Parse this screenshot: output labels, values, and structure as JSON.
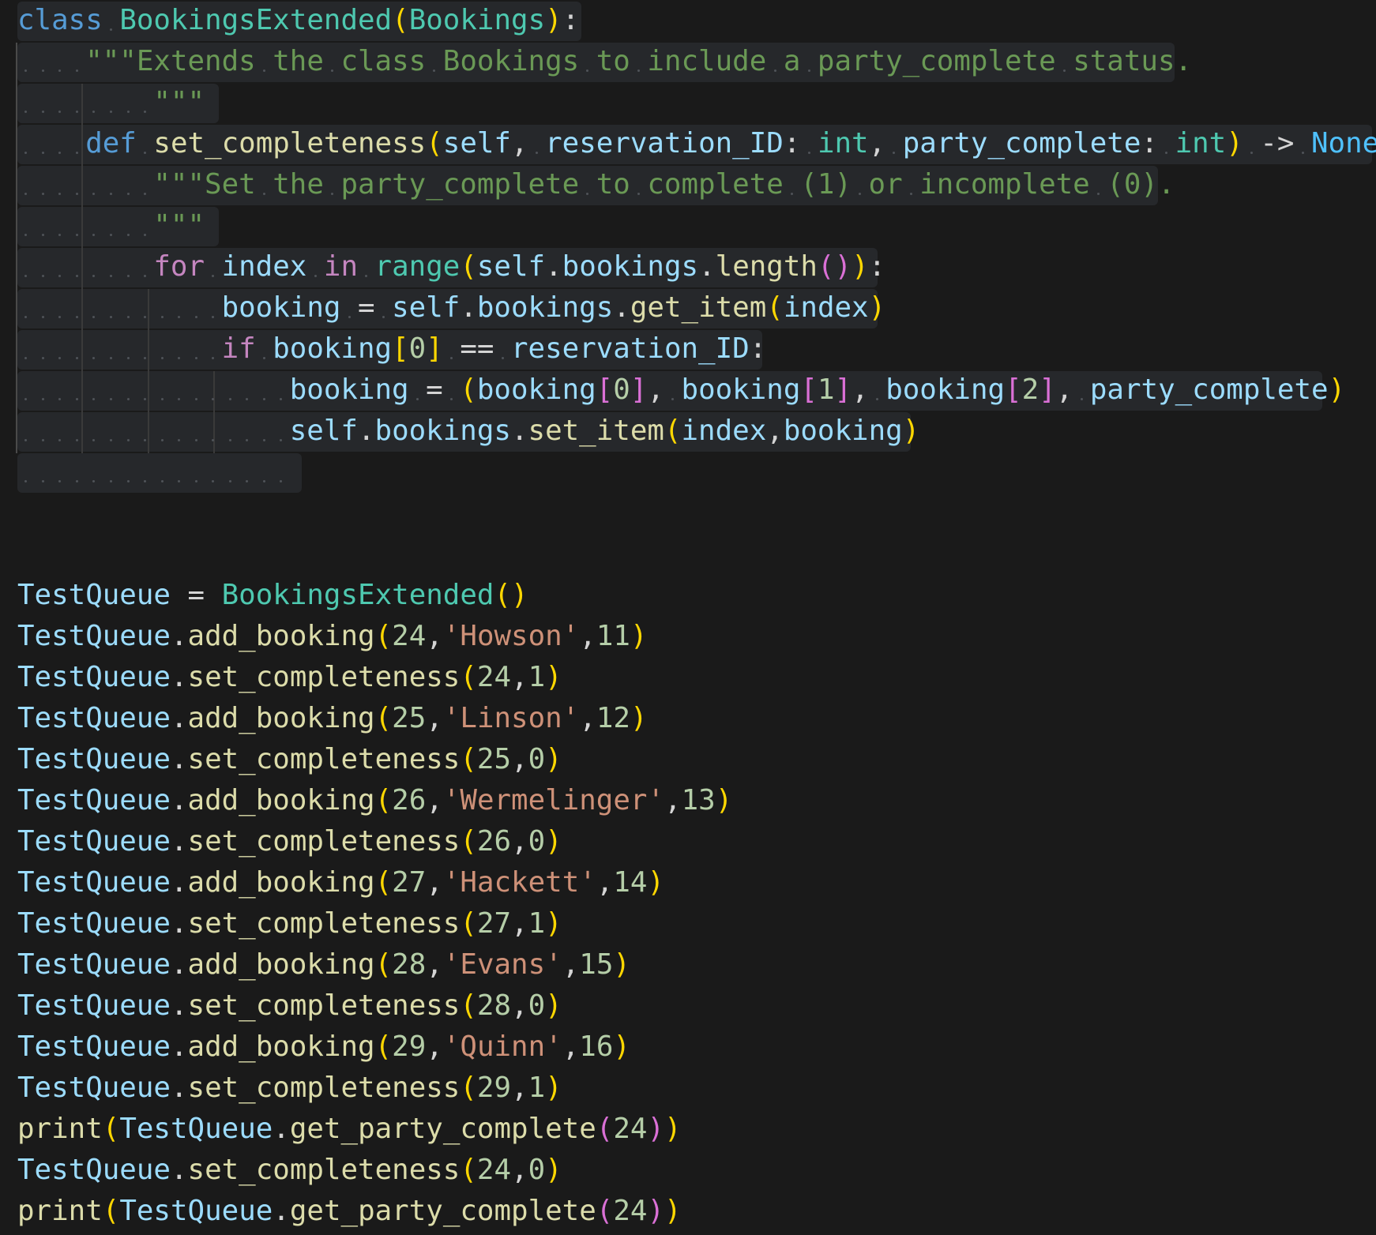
{
  "editor": {
    "language": "python",
    "lines": [
      [
        [
          "kw",
          "class"
        ],
        [
          "sp",
          " "
        ],
        [
          "cls",
          "BookingsExtended"
        ],
        [
          "b1",
          "("
        ],
        [
          "cls",
          "Bookings"
        ],
        [
          "b1",
          ")"
        ],
        [
          "op",
          ":"
        ]
      ],
      [
        [
          "sp",
          "    "
        ],
        [
          "doc",
          "\"\"\"Extends the class Bookings to include a party_complete status."
        ]
      ],
      [
        [
          "sp",
          "        "
        ],
        [
          "doc",
          "\"\"\""
        ]
      ],
      [
        [
          "sp",
          "    "
        ],
        [
          "kw",
          "def"
        ],
        [
          "sp",
          " "
        ],
        [
          "fn",
          "set_completeness"
        ],
        [
          "b1",
          "("
        ],
        [
          "var",
          "self"
        ],
        [
          "op",
          ","
        ],
        [
          "sp",
          " "
        ],
        [
          "var",
          "reservation_ID"
        ],
        [
          "op",
          ":"
        ],
        [
          "sp",
          " "
        ],
        [
          "bi",
          "int"
        ],
        [
          "op",
          ","
        ],
        [
          "sp",
          " "
        ],
        [
          "var",
          "party_complete"
        ],
        [
          "op",
          ":"
        ],
        [
          "sp",
          " "
        ],
        [
          "bi",
          "int"
        ],
        [
          "b1",
          ")"
        ],
        [
          "sp",
          " "
        ],
        [
          "op",
          "->"
        ],
        [
          "sp",
          " "
        ],
        [
          "const",
          "None"
        ],
        [
          "op",
          ":"
        ]
      ],
      [
        [
          "sp",
          "        "
        ],
        [
          "doc",
          "\"\"\"Set the party_complete to complete (1) or incomplete (0)."
        ]
      ],
      [
        [
          "sp",
          "        "
        ],
        [
          "doc",
          "\"\"\""
        ]
      ],
      [
        [
          "sp",
          "        "
        ],
        [
          "ctl",
          "for"
        ],
        [
          "sp",
          " "
        ],
        [
          "var",
          "index"
        ],
        [
          "sp",
          " "
        ],
        [
          "ctl",
          "in"
        ],
        [
          "sp",
          " "
        ],
        [
          "bi",
          "range"
        ],
        [
          "b1",
          "("
        ],
        [
          "var",
          "self"
        ],
        [
          "op",
          "."
        ],
        [
          "var",
          "bookings"
        ],
        [
          "op",
          "."
        ],
        [
          "fn",
          "length"
        ],
        [
          "b2",
          "()"
        ],
        [
          "b1",
          ")"
        ],
        [
          "op",
          ":"
        ]
      ],
      [
        [
          "sp",
          "            "
        ],
        [
          "var",
          "booking"
        ],
        [
          "sp",
          " "
        ],
        [
          "op",
          "="
        ],
        [
          "sp",
          " "
        ],
        [
          "var",
          "self"
        ],
        [
          "op",
          "."
        ],
        [
          "var",
          "bookings"
        ],
        [
          "op",
          "."
        ],
        [
          "fn",
          "get_item"
        ],
        [
          "b1",
          "("
        ],
        [
          "var",
          "index"
        ],
        [
          "b1",
          ")"
        ]
      ],
      [
        [
          "sp",
          "            "
        ],
        [
          "ctl",
          "if"
        ],
        [
          "sp",
          " "
        ],
        [
          "var",
          "booking"
        ],
        [
          "b1",
          "["
        ],
        [
          "num",
          "0"
        ],
        [
          "b1",
          "]"
        ],
        [
          "sp",
          " "
        ],
        [
          "op",
          "=="
        ],
        [
          "sp",
          " "
        ],
        [
          "var",
          "reservation_ID"
        ],
        [
          "op",
          ":"
        ]
      ],
      [
        [
          "sp",
          "                "
        ],
        [
          "var",
          "booking"
        ],
        [
          "sp",
          " "
        ],
        [
          "op",
          "="
        ],
        [
          "sp",
          " "
        ],
        [
          "b1",
          "("
        ],
        [
          "var",
          "booking"
        ],
        [
          "b2",
          "["
        ],
        [
          "num",
          "0"
        ],
        [
          "b2",
          "]"
        ],
        [
          "op",
          ","
        ],
        [
          "sp",
          " "
        ],
        [
          "var",
          "booking"
        ],
        [
          "b2",
          "["
        ],
        [
          "num",
          "1"
        ],
        [
          "b2",
          "]"
        ],
        [
          "op",
          ","
        ],
        [
          "sp",
          " "
        ],
        [
          "var",
          "booking"
        ],
        [
          "b2",
          "["
        ],
        [
          "num",
          "2"
        ],
        [
          "b2",
          "]"
        ],
        [
          "op",
          ","
        ],
        [
          "sp",
          " "
        ],
        [
          "var",
          "party_complete"
        ],
        [
          "b1",
          ")"
        ]
      ],
      [
        [
          "sp",
          "                "
        ],
        [
          "var",
          "self"
        ],
        [
          "op",
          "."
        ],
        [
          "var",
          "bookings"
        ],
        [
          "op",
          "."
        ],
        [
          "fn",
          "set_item"
        ],
        [
          "b1",
          "("
        ],
        [
          "var",
          "index"
        ],
        [
          "op",
          ","
        ],
        [
          "var",
          "booking"
        ],
        [
          "b1",
          ")"
        ]
      ],
      [
        [
          "sp",
          "                "
        ]
      ],
      [],
      [],
      [
        [
          "var",
          "TestQueue"
        ],
        [
          "op",
          " = "
        ],
        [
          "cls",
          "BookingsExtended"
        ],
        [
          "b1",
          "()"
        ]
      ],
      [
        [
          "var",
          "TestQueue"
        ],
        [
          "op",
          "."
        ],
        [
          "fn",
          "add_booking"
        ],
        [
          "b1",
          "("
        ],
        [
          "num",
          "24"
        ],
        [
          "op",
          ","
        ],
        [
          "str",
          "'Howson'"
        ],
        [
          "op",
          ","
        ],
        [
          "num",
          "11"
        ],
        [
          "b1",
          ")"
        ]
      ],
      [
        [
          "var",
          "TestQueue"
        ],
        [
          "op",
          "."
        ],
        [
          "fn",
          "set_completeness"
        ],
        [
          "b1",
          "("
        ],
        [
          "num",
          "24"
        ],
        [
          "op",
          ","
        ],
        [
          "num",
          "1"
        ],
        [
          "b1",
          ")"
        ]
      ],
      [
        [
          "var",
          "TestQueue"
        ],
        [
          "op",
          "."
        ],
        [
          "fn",
          "add_booking"
        ],
        [
          "b1",
          "("
        ],
        [
          "num",
          "25"
        ],
        [
          "op",
          ","
        ],
        [
          "str",
          "'Linson'"
        ],
        [
          "op",
          ","
        ],
        [
          "num",
          "12"
        ],
        [
          "b1",
          ")"
        ]
      ],
      [
        [
          "var",
          "TestQueue"
        ],
        [
          "op",
          "."
        ],
        [
          "fn",
          "set_completeness"
        ],
        [
          "b1",
          "("
        ],
        [
          "num",
          "25"
        ],
        [
          "op",
          ","
        ],
        [
          "num",
          "0"
        ],
        [
          "b1",
          ")"
        ]
      ],
      [
        [
          "var",
          "TestQueue"
        ],
        [
          "op",
          "."
        ],
        [
          "fn",
          "add_booking"
        ],
        [
          "b1",
          "("
        ],
        [
          "num",
          "26"
        ],
        [
          "op",
          ","
        ],
        [
          "str",
          "'Wermelinger'"
        ],
        [
          "op",
          ","
        ],
        [
          "num",
          "13"
        ],
        [
          "b1",
          ")"
        ]
      ],
      [
        [
          "var",
          "TestQueue"
        ],
        [
          "op",
          "."
        ],
        [
          "fn",
          "set_completeness"
        ],
        [
          "b1",
          "("
        ],
        [
          "num",
          "26"
        ],
        [
          "op",
          ","
        ],
        [
          "num",
          "0"
        ],
        [
          "b1",
          ")"
        ]
      ],
      [
        [
          "var",
          "TestQueue"
        ],
        [
          "op",
          "."
        ],
        [
          "fn",
          "add_booking"
        ],
        [
          "b1",
          "("
        ],
        [
          "num",
          "27"
        ],
        [
          "op",
          ","
        ],
        [
          "str",
          "'Hackett'"
        ],
        [
          "op",
          ","
        ],
        [
          "num",
          "14"
        ],
        [
          "b1",
          ")"
        ]
      ],
      [
        [
          "var",
          "TestQueue"
        ],
        [
          "op",
          "."
        ],
        [
          "fn",
          "set_completeness"
        ],
        [
          "b1",
          "("
        ],
        [
          "num",
          "27"
        ],
        [
          "op",
          ","
        ],
        [
          "num",
          "1"
        ],
        [
          "b1",
          ")"
        ]
      ],
      [
        [
          "var",
          "TestQueue"
        ],
        [
          "op",
          "."
        ],
        [
          "fn",
          "add_booking"
        ],
        [
          "b1",
          "("
        ],
        [
          "num",
          "28"
        ],
        [
          "op",
          ","
        ],
        [
          "str",
          "'Evans'"
        ],
        [
          "op",
          ","
        ],
        [
          "num",
          "15"
        ],
        [
          "b1",
          ")"
        ]
      ],
      [
        [
          "var",
          "TestQueue"
        ],
        [
          "op",
          "."
        ],
        [
          "fn",
          "set_completeness"
        ],
        [
          "b1",
          "("
        ],
        [
          "num",
          "28"
        ],
        [
          "op",
          ","
        ],
        [
          "num",
          "0"
        ],
        [
          "b1",
          ")"
        ]
      ],
      [
        [
          "var",
          "TestQueue"
        ],
        [
          "op",
          "."
        ],
        [
          "fn",
          "add_booking"
        ],
        [
          "b1",
          "("
        ],
        [
          "num",
          "29"
        ],
        [
          "op",
          ","
        ],
        [
          "str",
          "'Quinn'"
        ],
        [
          "op",
          ","
        ],
        [
          "num",
          "16"
        ],
        [
          "b1",
          ")"
        ]
      ],
      [
        [
          "var",
          "TestQueue"
        ],
        [
          "op",
          "."
        ],
        [
          "fn",
          "set_completeness"
        ],
        [
          "b1",
          "("
        ],
        [
          "num",
          "29"
        ],
        [
          "op",
          ","
        ],
        [
          "num",
          "1"
        ],
        [
          "b1",
          ")"
        ]
      ],
      [
        [
          "fn",
          "print"
        ],
        [
          "b1",
          "("
        ],
        [
          "var",
          "TestQueue"
        ],
        [
          "op",
          "."
        ],
        [
          "fn",
          "get_party_complete"
        ],
        [
          "b2",
          "("
        ],
        [
          "num",
          "24"
        ],
        [
          "b2",
          ")"
        ],
        [
          "b1",
          ")"
        ]
      ],
      [
        [
          "var",
          "TestQueue"
        ],
        [
          "op",
          "."
        ],
        [
          "fn",
          "set_completeness"
        ],
        [
          "b1",
          "("
        ],
        [
          "num",
          "24"
        ],
        [
          "op",
          ","
        ],
        [
          "num",
          "0"
        ],
        [
          "b1",
          ")"
        ]
      ],
      [
        [
          "fn",
          "print"
        ],
        [
          "b1",
          "("
        ],
        [
          "var",
          "TestQueue"
        ],
        [
          "op",
          "."
        ],
        [
          "fn",
          "get_party_complete"
        ],
        [
          "b2",
          "("
        ],
        [
          "num",
          "24"
        ],
        [
          "b2",
          ")"
        ],
        [
          "b1",
          ")"
        ]
      ]
    ]
  },
  "colors": {
    "background": "#1a1a1a",
    "selection": "#26282b",
    "keyword": "#569cd6",
    "control": "#c586c0",
    "class": "#4ec9b0",
    "function": "#dcdcaa",
    "variable": "#9cdcfe",
    "string": "#ce9178",
    "docstring": "#6a9955",
    "number": "#b5cea8",
    "bracket_1": "#ffd700",
    "bracket_2": "#da70d6"
  }
}
